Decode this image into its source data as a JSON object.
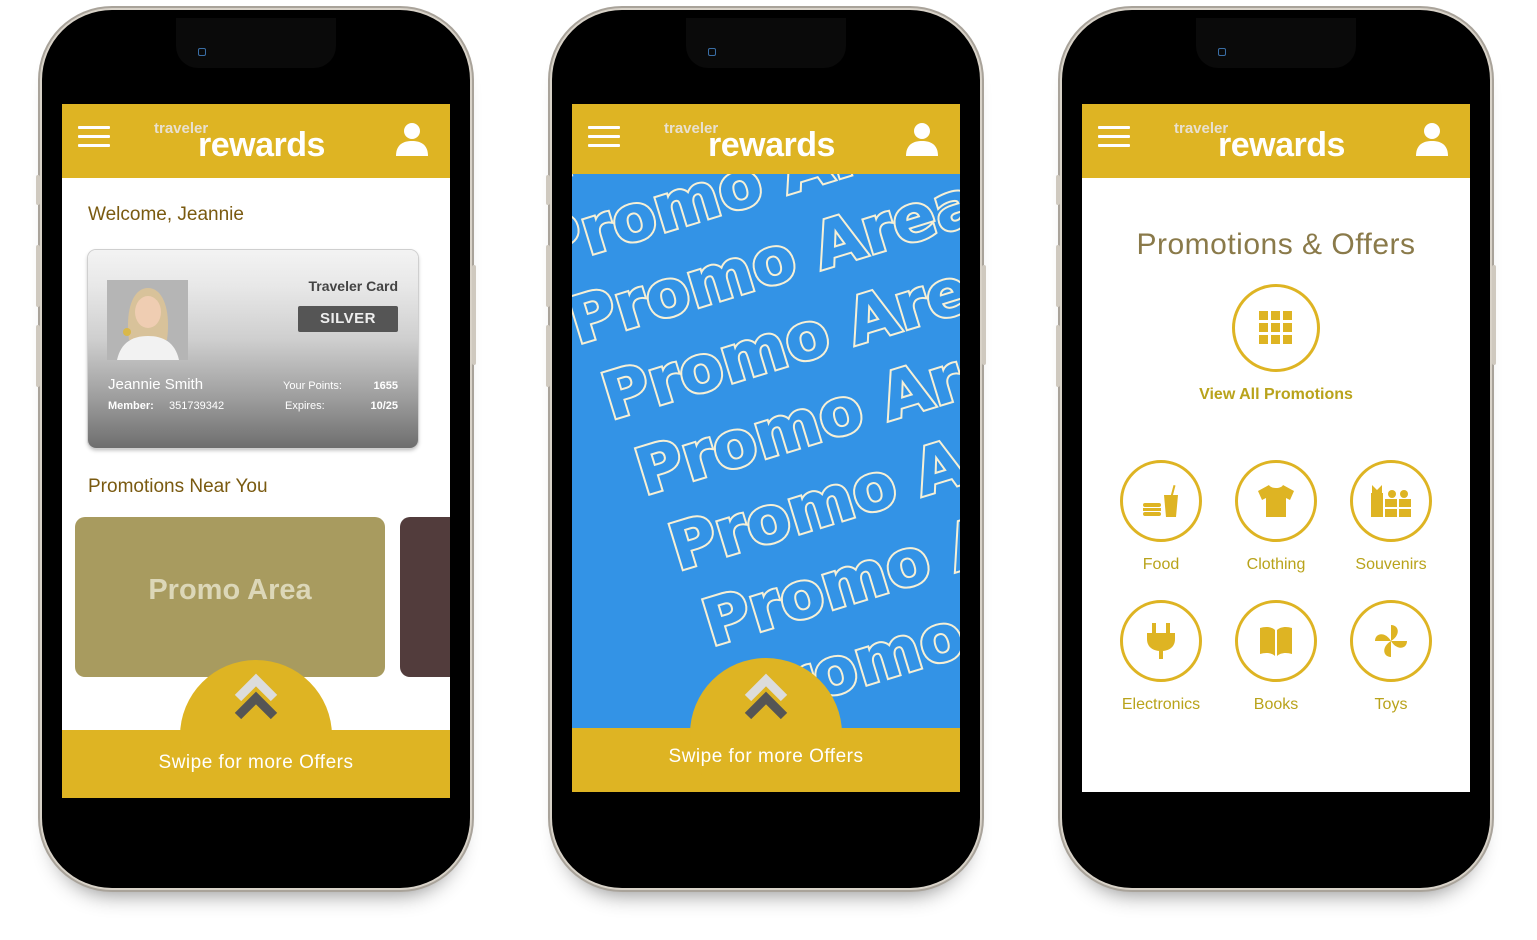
{
  "app": {
    "logo_small": "traveler",
    "logo_big": "rewards",
    "brand_color": "#deb423"
  },
  "screens": [
    {
      "name": "home",
      "welcome": "Welcome, Jeannie",
      "card": {
        "title": "Traveler Card",
        "tier": "SILVER",
        "name": "Jeannie Smith",
        "member_label": "Member:",
        "member_id": "351739342",
        "points_label": "Your Points:",
        "points": "1655",
        "expires_label": "Expires:",
        "expires": "10/25"
      },
      "promos_heading": "Promotions Near You",
      "promo_tiles": [
        {
          "label": "Promo Area",
          "color": "#a89b5f"
        },
        {
          "label": "",
          "color": "#523c3c"
        }
      ],
      "swipe_text": "Swipe for more Offers"
    },
    {
      "name": "promo",
      "promo_text": "Promo Area",
      "promo_color": "#3393e6",
      "swipe_text": "Swipe for more Offers"
    },
    {
      "name": "offers",
      "title": "Promotions & Offers",
      "view_all": "View All Promotions",
      "categories": [
        {
          "label": "Food",
          "icon": "food-icon"
        },
        {
          "label": "Clothing",
          "icon": "tshirt-icon"
        },
        {
          "label": "Souvenirs",
          "icon": "gift-icon"
        },
        {
          "label": "Electronics",
          "icon": "plug-icon"
        },
        {
          "label": "Books",
          "icon": "book-icon"
        },
        {
          "label": "Toys",
          "icon": "pinwheel-icon"
        }
      ]
    }
  ]
}
